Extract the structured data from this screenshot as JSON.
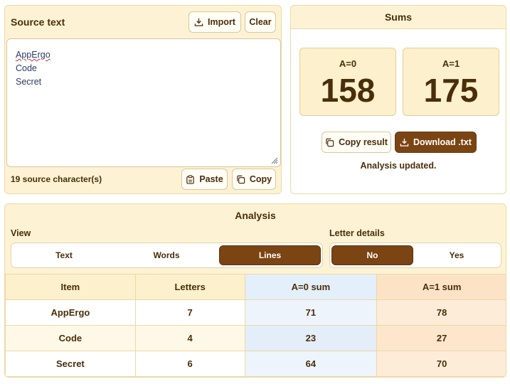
{
  "source": {
    "title": "Source text",
    "import_label": "Import",
    "clear_label": "Clear",
    "lines": [
      "AppErgo",
      "Code",
      "Secret"
    ],
    "char_count": "19 source character(s)",
    "paste_label": "Paste",
    "copy_label": "Copy"
  },
  "sums": {
    "title": "Sums",
    "a0_label": "A=0",
    "a0_value": "158",
    "a1_label": "A=1",
    "a1_value": "175",
    "copy_result_label": "Copy result",
    "download_label": "Download .txt",
    "status": "Analysis updated."
  },
  "analysis": {
    "title": "Analysis",
    "view_label": "View",
    "view_options": [
      "Text",
      "Words",
      "Lines"
    ],
    "view_selected": "Lines",
    "letter_label": "Letter details",
    "letter_options": [
      "No",
      "Yes"
    ],
    "letter_selected": "No",
    "columns": [
      "Item",
      "Letters",
      "A=0 sum",
      "A=1 sum"
    ],
    "rows": [
      [
        "AppErgo",
        "7",
        "71",
        "78"
      ],
      [
        "Code",
        "4",
        "23",
        "27"
      ],
      [
        "Secret",
        "6",
        "64",
        "70"
      ]
    ]
  },
  "colors": {
    "accent": "#7a4413",
    "panel": "#fdf3d4",
    "a0_column": "#e3effa",
    "a1_column": "#fde3c6"
  }
}
